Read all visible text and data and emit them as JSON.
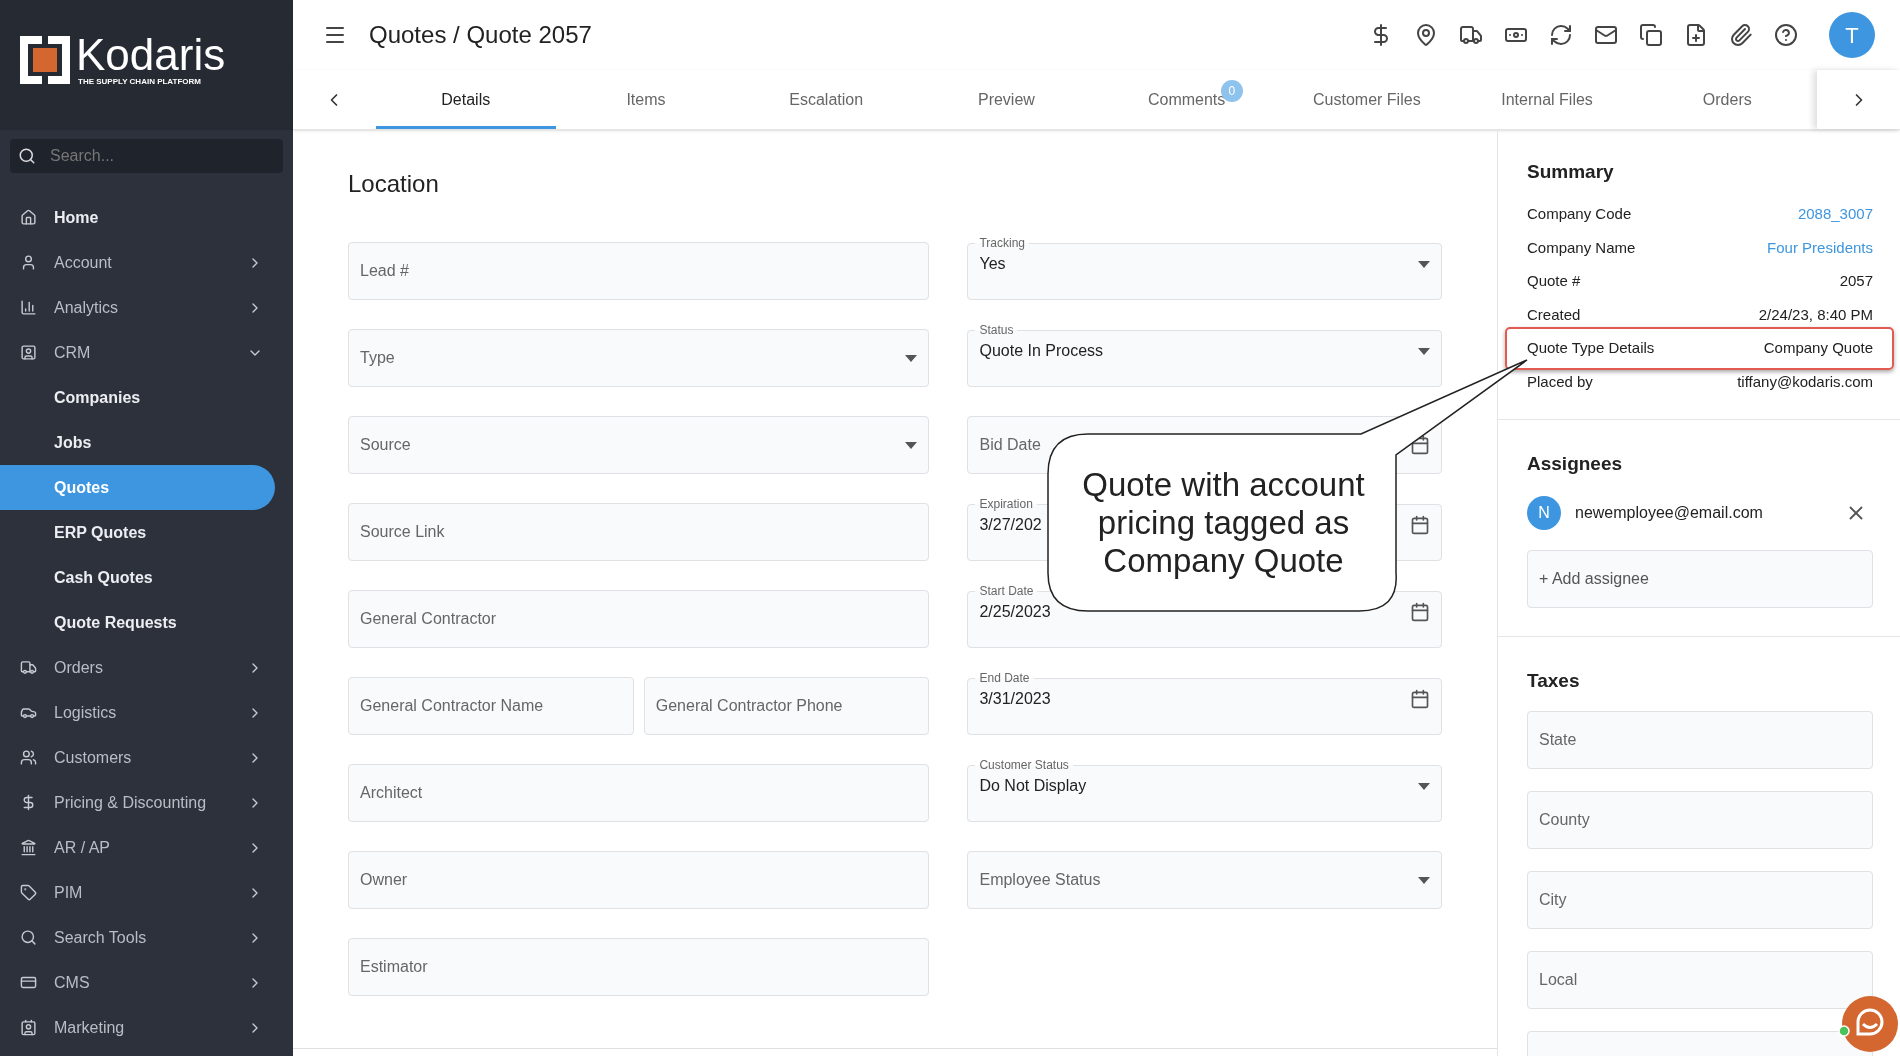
{
  "sidebar": {
    "logo": {
      "name": "Kodaris",
      "tagline": "THE SUPPLY CHAIN PLATFORM"
    },
    "search": {
      "placeholder": "Search..."
    },
    "items": [
      {
        "label": "Home",
        "kind": "link",
        "selected": false
      },
      {
        "label": "Account",
        "kind": "group",
        "selected": false,
        "expanded": false
      },
      {
        "label": "Analytics",
        "kind": "group",
        "selected": false,
        "expanded": false
      },
      {
        "label": "CRM",
        "kind": "group",
        "selected": false,
        "expanded": true
      },
      {
        "label": "Companies",
        "kind": "sub",
        "selected": false
      },
      {
        "label": "Jobs",
        "kind": "sub",
        "selected": false
      },
      {
        "label": "Quotes",
        "kind": "sub",
        "selected": true
      },
      {
        "label": "ERP Quotes",
        "kind": "sub",
        "selected": false
      },
      {
        "label": "Cash Quotes",
        "kind": "sub",
        "selected": false
      },
      {
        "label": "Quote Requests",
        "kind": "sub",
        "selected": false
      },
      {
        "label": "Orders",
        "kind": "group",
        "selected": false,
        "expanded": false
      },
      {
        "label": "Logistics",
        "kind": "group",
        "selected": false,
        "expanded": false
      },
      {
        "label": "Customers",
        "kind": "group",
        "selected": false,
        "expanded": false
      },
      {
        "label": "Pricing & Discounting",
        "kind": "group",
        "selected": false,
        "expanded": false
      },
      {
        "label": "AR / AP",
        "kind": "group",
        "selected": false,
        "expanded": false
      },
      {
        "label": "PIM",
        "kind": "group",
        "selected": false,
        "expanded": false
      },
      {
        "label": "Search Tools",
        "kind": "group",
        "selected": false,
        "expanded": false
      },
      {
        "label": "CMS",
        "kind": "group",
        "selected": false,
        "expanded": false
      },
      {
        "label": "Marketing",
        "kind": "group",
        "selected": false,
        "expanded": false
      }
    ]
  },
  "header": {
    "title": "Quotes / Quote 2057",
    "avatar": "T"
  },
  "tabs": [
    {
      "label": "Details",
      "selected": true
    },
    {
      "label": "Items",
      "selected": false
    },
    {
      "label": "Escalation",
      "selected": false
    },
    {
      "label": "Preview",
      "selected": false
    },
    {
      "label": "Comments",
      "selected": false,
      "badge": "0"
    },
    {
      "label": "Customer Files",
      "selected": false
    },
    {
      "label": "Internal Files",
      "selected": false
    },
    {
      "label": "Orders",
      "selected": false
    }
  ],
  "form": {
    "title": "Location",
    "left": [
      {
        "kind": "text",
        "placeholder": "Lead #"
      },
      {
        "kind": "select",
        "placeholder": "Type"
      },
      {
        "kind": "select",
        "placeholder": "Source"
      },
      {
        "kind": "text",
        "placeholder": "Source Link"
      },
      {
        "kind": "text",
        "placeholder": "General Contractor"
      },
      {
        "kind": "pair",
        "fields": [
          {
            "kind": "text",
            "placeholder": "General Contractor Name"
          },
          {
            "kind": "text",
            "placeholder": "General Contractor Phone"
          }
        ]
      },
      {
        "kind": "text",
        "placeholder": "Architect"
      },
      {
        "kind": "text",
        "placeholder": "Owner"
      },
      {
        "kind": "text",
        "placeholder": "Estimator"
      }
    ],
    "right": [
      {
        "kind": "select",
        "label": "Tracking",
        "value": "Yes"
      },
      {
        "kind": "select",
        "label": "Status",
        "value": "Quote In Process"
      },
      {
        "kind": "date",
        "placeholder": "Bid Date"
      },
      {
        "kind": "date",
        "label": "Expiration",
        "value": "3/27/202"
      },
      {
        "kind": "date",
        "label": "Start Date",
        "value": "2/25/2023"
      },
      {
        "kind": "date",
        "label": "End Date",
        "value": "3/31/2023"
      },
      {
        "kind": "select",
        "label": "Customer Status",
        "value": "Do Not Display"
      },
      {
        "kind": "select",
        "placeholder": "Employee Status"
      }
    ]
  },
  "summary": {
    "title": "Summary",
    "rows": [
      {
        "label": "Company Code",
        "value": "2088_3007",
        "link": true,
        "highlighted": false
      },
      {
        "label": "Company Name",
        "value": "Four Presidents",
        "link": true,
        "highlighted": false
      },
      {
        "label": "Quote #",
        "value": "2057",
        "link": false,
        "highlighted": false
      },
      {
        "label": "Created",
        "value": "2/24/23, 8:40 PM",
        "link": false,
        "highlighted": false
      },
      {
        "label": "Quote Type Details",
        "value": "Company Quote",
        "link": false,
        "highlighted": true
      },
      {
        "label": "Placed by",
        "value": "tiffany@kodaris.com",
        "link": false,
        "highlighted": false
      }
    ]
  },
  "assignees": {
    "title": "Assignees",
    "items": [
      {
        "initial": "N",
        "email": "newemployee@email.com"
      }
    ],
    "add": {
      "placeholder": "+ Add assignee"
    }
  },
  "taxes": {
    "title": "Taxes",
    "fields": [
      {
        "placeholder": "State"
      },
      {
        "placeholder": "County"
      },
      {
        "placeholder": "City"
      },
      {
        "placeholder": "Local"
      }
    ]
  },
  "callout": {
    "text": "Quote with account pricing tagged as Company Quote"
  }
}
